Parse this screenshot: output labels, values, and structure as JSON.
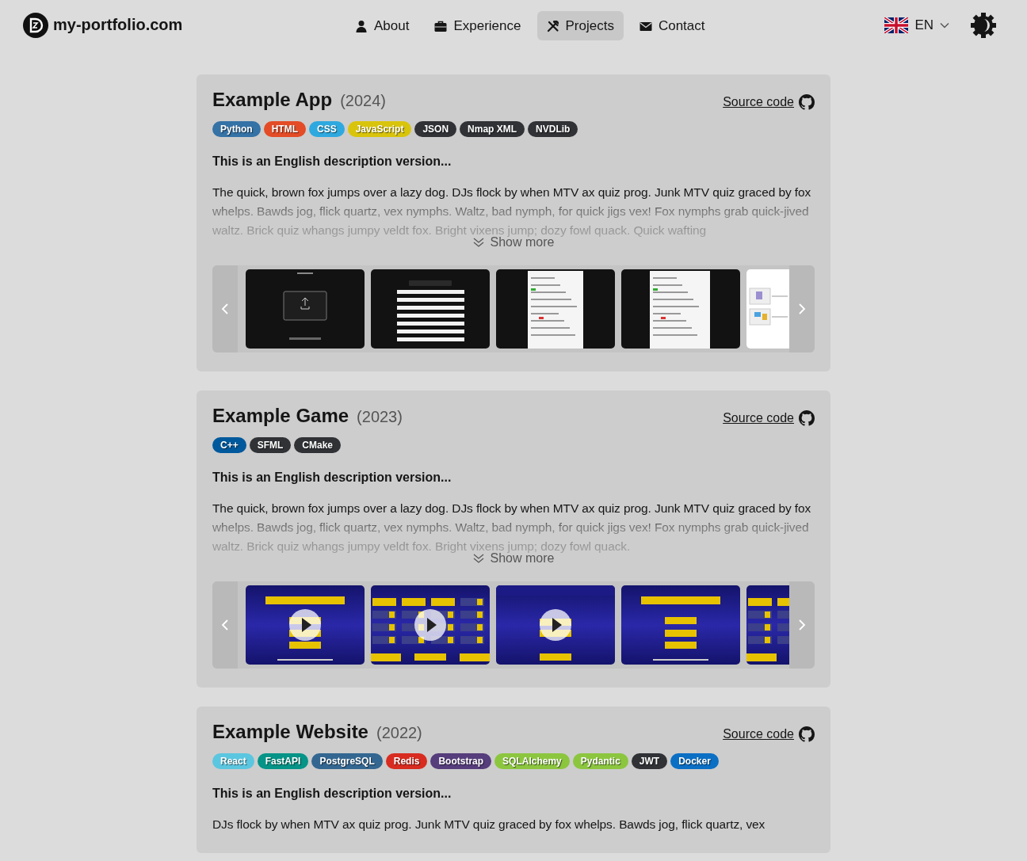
{
  "header": {
    "logo_text": "my-portfolio.com",
    "nav": [
      {
        "label": "About",
        "kind": "person",
        "selected": false
      },
      {
        "label": "Experience",
        "kind": "briefcase",
        "selected": false
      },
      {
        "label": "Projects",
        "kind": "tools",
        "selected": true
      },
      {
        "label": "Contact",
        "kind": "envelope",
        "selected": false
      }
    ],
    "language": {
      "code": "EN"
    }
  },
  "projects": [
    {
      "title": "Example App",
      "year": "(2024)",
      "source_link": "Source code",
      "tags": [
        {
          "label": "Python",
          "color": "#3572a5"
        },
        {
          "label": "HTML",
          "color": "#e34c26"
        },
        {
          "label": "CSS",
          "color": "#2ea9df"
        },
        {
          "label": "JavaScript",
          "color": "#d9c40c"
        },
        {
          "label": "JSON",
          "color": "#303236"
        },
        {
          "label": "Nmap XML",
          "color": "#303236"
        },
        {
          "label": "NVDLib",
          "color": "#303236"
        }
      ],
      "summary": "This is an English description version...",
      "description": "The quick, brown fox jumps over a lazy dog. DJs flock by when MTV ax quiz prog. Junk MTV quiz graced by fox whelps. Bawds jog, flick quartz, vex nymphs. Waltz, bad nymph, for quick jigs vex! Fox nymphs grab quick-jived waltz. Brick quiz whangs jumpy veldt fox. Bright vixens jump; dozy fowl quack. Quick wafting",
      "show_more": "Show more",
      "gallery": [
        {
          "kind": "picture"
        },
        {
          "kind": "picture"
        },
        {
          "kind": "picture"
        },
        {
          "kind": "picture"
        },
        {
          "kind": "picture"
        }
      ]
    },
    {
      "title": "Example Game",
      "year": "(2023)",
      "source_link": "Source code",
      "tags": [
        {
          "label": "C++",
          "color": "#00599c"
        },
        {
          "label": "SFML",
          "color": "#303236"
        },
        {
          "label": "CMake",
          "color": "#303236"
        }
      ],
      "summary": "This is an English description version...",
      "description": "The quick, brown fox jumps over a lazy dog. DJs flock by when MTV ax quiz prog. Junk MTV quiz graced by fox whelps. Bawds jog, flick quartz, vex nymphs. Waltz, bad nymph, for quick jigs vex! Fox nymphs grab quick-jived waltz. Brick quiz whangs jumpy veldt fox. Bright vixens jump; dozy fowl quack.",
      "show_more": "Show more",
      "gallery": [
        {
          "kind": "video"
        },
        {
          "kind": "video"
        },
        {
          "kind": "video"
        },
        {
          "kind": "picture"
        },
        {
          "kind": "picture"
        }
      ]
    },
    {
      "title": "Example Website",
      "year": "(2022)",
      "source_link": "Source code",
      "tags": [
        {
          "label": "React",
          "color": "#5bc6e0"
        },
        {
          "label": "FastAPI",
          "color": "#059487"
        },
        {
          "label": "PostgreSQL",
          "color": "#336791"
        },
        {
          "label": "Redis",
          "color": "#d82c20"
        },
        {
          "label": "Bootstrap",
          "color": "#563d7c"
        },
        {
          "label": "SQLAlchemy",
          "color": "#8cc63f"
        },
        {
          "label": "Pydantic",
          "color": "#8cc63f"
        },
        {
          "label": "JWT",
          "color": "#303236"
        },
        {
          "label": "Docker",
          "color": "#0b6fc4"
        }
      ],
      "summary": "This is an English description version...",
      "description": "DJs flock by when MTV ax quiz prog. Junk MTV quiz graced by fox whelps. Bawds jog, flick quartz, vex"
    }
  ]
}
